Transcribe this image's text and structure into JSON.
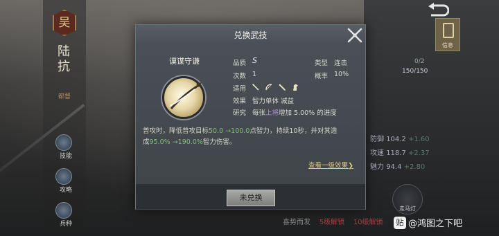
{
  "modal": {
    "title": "兑换武技",
    "skill_name": "谟谋守谦",
    "labels": {
      "quality": "品质",
      "type": "类型",
      "count": "次数",
      "rate": "概率",
      "applicable": "适用",
      "effect": "效果",
      "research": "研究"
    },
    "values": {
      "quality": "S",
      "type": "连击",
      "count": "1",
      "rate": "10%",
      "effect": "智力单体 减益",
      "research_prefix": "每张",
      "research_highlight": "上将",
      "research_suffix": "增加 5.00% 的进度"
    },
    "applicable_icons": [
      "spear-icon",
      "bow-icon",
      "blade-icon",
      "horse-icon"
    ],
    "description": {
      "p1": "普攻时，降低普攻目标",
      "g1": "50.0 →100.0",
      "p2": "点智力，持续10秒，并对其造",
      "p3": "成",
      "g2": "95.0% →190.0%",
      "p4": "智力伤害。"
    },
    "link_text": "查看一级效果",
    "button_label": "未兑换"
  },
  "hero": {
    "faction": "吴",
    "name": "陆抗",
    "title": "都督"
  },
  "side_labels": [
    "技能",
    "攻略",
    "兵种"
  ],
  "right_panel": {
    "counter_top": "0/2",
    "counter_hp": "150/150",
    "stats": [
      {
        "label": "防御",
        "value": "104.2",
        "plus": "+1.60"
      },
      {
        "label": "攻速",
        "value": "118.7",
        "plus": "+2.37"
      },
      {
        "label": "魅力",
        "value": "94.4",
        "plus": "+2.80"
      }
    ],
    "scroll_label": "信息",
    "round_button_label": "走马灯"
  },
  "bottom_strip": {
    "normal": "喜势而发",
    "red1": "5级解锁",
    "red2": "10级解锁"
  },
  "watermark": {
    "logo": "贴",
    "text": "@鸿图之下吧"
  }
}
